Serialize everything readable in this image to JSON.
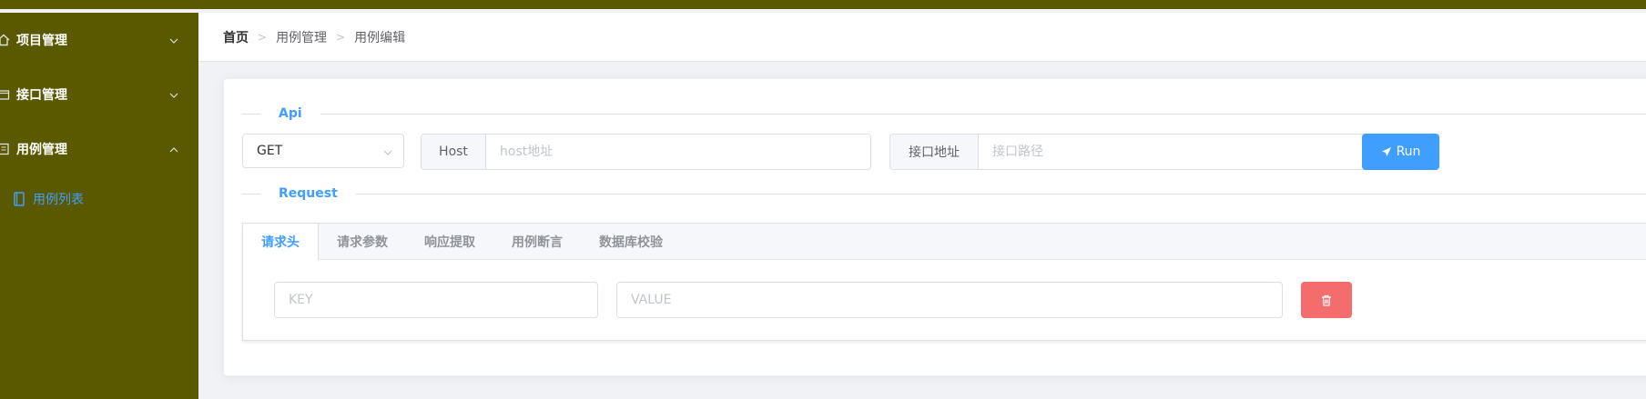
{
  "sidebar": {
    "items": [
      {
        "label": "项目管理",
        "icon": "home-icon"
      },
      {
        "label": "接口管理",
        "icon": "folder-icon"
      },
      {
        "label": "用例管理",
        "icon": "document-icon"
      }
    ],
    "submenu": {
      "label": "用例列表",
      "icon": "notebook-icon"
    }
  },
  "breadcrumb": [
    "首页",
    "用例管理",
    "用例编辑"
  ],
  "sections": {
    "api": "Api",
    "request": "Request"
  },
  "api": {
    "method": "GET",
    "host_label": "Host",
    "host_placeholder": "host地址",
    "path_label": "接口地址",
    "path_placeholder": "接口路径",
    "run_label": "Run"
  },
  "tabs": [
    "请求头",
    "请求参数",
    "响应提取",
    "用例断言",
    "数据库校验"
  ],
  "header_row": {
    "key_placeholder": "KEY",
    "value_placeholder": "VALUE"
  },
  "colors": {
    "sidebar": "#5b5900",
    "primary": "#409eff",
    "danger": "#f56c6c"
  }
}
